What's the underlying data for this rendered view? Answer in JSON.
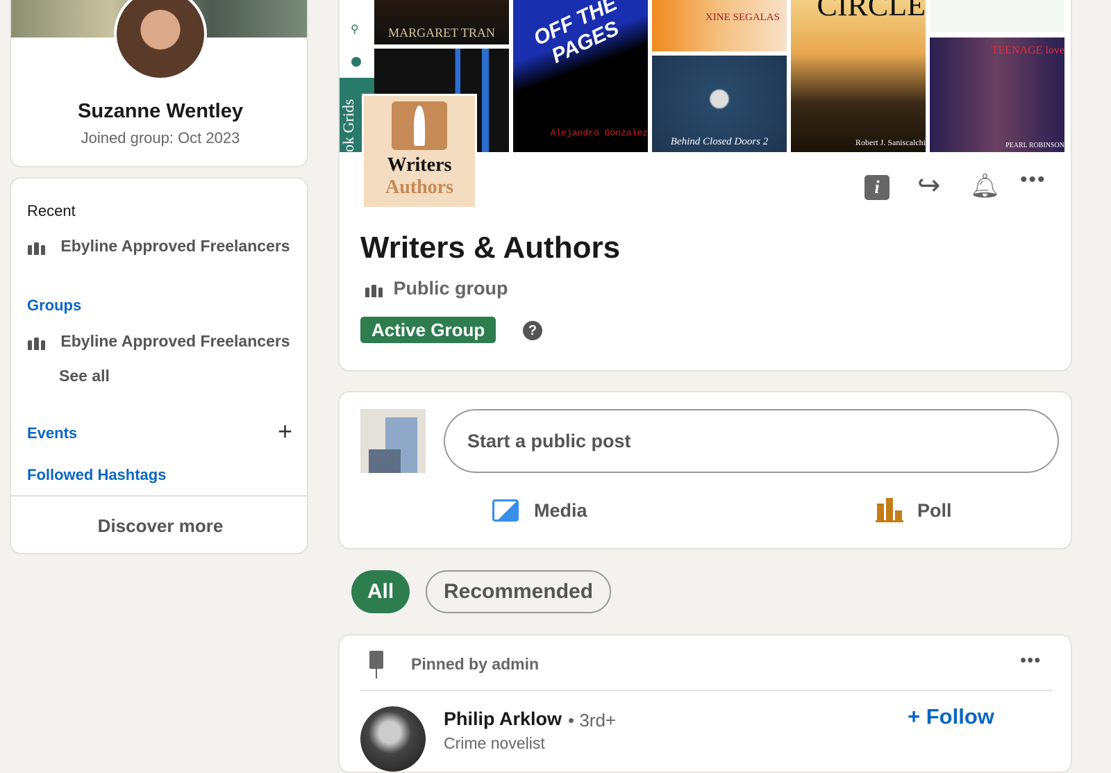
{
  "profile": {
    "name": "Suzanne Wentley",
    "joined": "Joined group: Oct 2023"
  },
  "nav": {
    "recent_label": "Recent",
    "recent_items": [
      "Ebyline Approved Freelancers"
    ],
    "groups_label": "Groups",
    "group_items": [
      "Ebyline Approved Freelancers"
    ],
    "see_all": "See all",
    "events_label": "Events",
    "hashtags_label": "Followed Hashtags",
    "discover": "Discover more"
  },
  "banner": {
    "covers": [
      "MARGARET TRAN",
      "OFF THE PAGES",
      "Alejandro Gonzalez",
      "XINE SEGALAS",
      "Behind Closed Doors 2",
      "CIRCLE",
      "Robert J. Saniscalchi",
      "TEENAGE love",
      "PEARL ROBINSON"
    ],
    "side_text": "ok Grids"
  },
  "group": {
    "logo_line1": "Writers",
    "logo_line2": "Authors",
    "title": "Writers & Authors",
    "visibility": "Public group",
    "badge": "Active Group",
    "accent": "#2e7d4f"
  },
  "composer": {
    "placeholder": "Start a public post",
    "media": "Media",
    "poll": "Poll"
  },
  "filters": {
    "all": "All",
    "recommended": "Recommended"
  },
  "post": {
    "pinned": "Pinned by admin",
    "author": "Philip Arklow",
    "degree": "• 3rd+",
    "headline": "Crime novelist",
    "follow": "Follow"
  }
}
